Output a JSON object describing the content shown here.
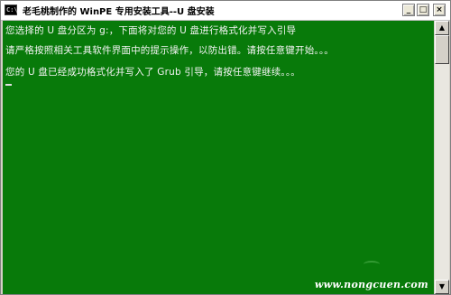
{
  "window": {
    "title": "老毛桃制作的 WinPE 专用安装工具--U 盘安装",
    "icon": "cmd-icon"
  },
  "titlebar_buttons": {
    "minimize": "_",
    "maximize": "□",
    "close": "×"
  },
  "console": {
    "lines": [
      "您选择的 U 盘分区为 g:，下面将对您的 U 盘进行格式化并写入引导",
      "请严格按照相关工具软件界面中的提示操作，以防出错。请按任意键开始。。。",
      "您的 U 盘已经成功格式化并写入了 Grub 引导，请按任意键继续。。。"
    ],
    "background": "#087a0a",
    "text_color": "#f4f4f4"
  },
  "watermark": {
    "text": "www.nongcuen.com",
    "note": "cn"
  },
  "scrollbar": {
    "up": "▲",
    "down": "▼"
  }
}
